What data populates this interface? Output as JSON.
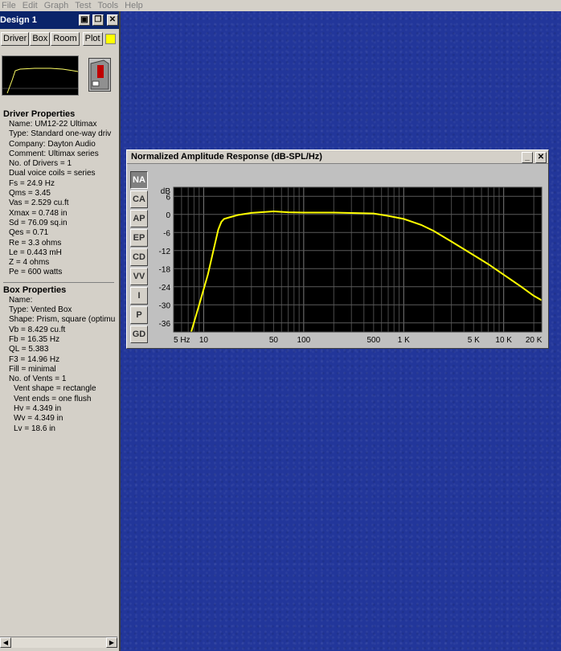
{
  "menu": [
    "File",
    "Edit",
    "Graph",
    "Test",
    "Tools",
    "Help"
  ],
  "design": {
    "title": "Design 1",
    "tabs": [
      "Driver",
      "Box",
      "Room",
      "Plot"
    ],
    "swatch_color": "#ffff00"
  },
  "driver": {
    "heading": "Driver Properties",
    "lines": [
      "Name: UM12-22  Ultimax",
      "Type: Standard one-way driv",
      "Company: Dayton Audio",
      "Comment: Ultimax series",
      "No. of Drivers = 1",
      "Dual voice coils = series",
      "Fs =  24.9 Hz",
      "Qms =  3.45",
      "Vas =  2.529 cu.ft",
      "Xmax =  0.748 in",
      "Sd =  76.09 sq.in",
      "Qes =  0.71",
      "Re =  3.3 ohms",
      "Le =  0.443 mH",
      "Z =  4 ohms",
      "Pe =  600 watts"
    ]
  },
  "box": {
    "heading": "Box Properties",
    "lines": [
      "Name:",
      "Type: Vented Box",
      "Shape: Prism, square (optimu",
      "Vb =  8.429 cu.ft",
      "Fb =  16.35 Hz",
      "QL =  5.383",
      "F3 =  14.96 Hz",
      "Fill = minimal",
      "No. of Vents = 1"
    ],
    "vent_lines": [
      "Vent shape = rectangle",
      "Vent ends = one flush",
      "Hv =  4.349 in",
      "Wv =  4.349 in",
      "Lv =  18.6 in"
    ]
  },
  "plot_window": {
    "title": "Normalized Amplitude Response (dB-SPL/Hz)",
    "side_tabs": [
      "NA",
      "CA",
      "AP",
      "EP",
      "CD",
      "VV",
      "I",
      "P",
      "GD"
    ],
    "active_tab": "NA"
  },
  "chart_data": {
    "type": "line",
    "xscale": "log",
    "xlim": [
      5,
      24000
    ],
    "ylim": [
      -39,
      9
    ],
    "yunit": "dB",
    "yticks": [
      6,
      0,
      -6,
      -12,
      -18,
      -24,
      -30,
      -36
    ],
    "xticks": [
      {
        "v": 5,
        "label": "5 Hz"
      },
      {
        "v": 10,
        "label": "10"
      },
      {
        "v": 50,
        "label": "50"
      },
      {
        "v": 100,
        "label": "100"
      },
      {
        "v": 500,
        "label": "500"
      },
      {
        "v": 1000,
        "label": "1 K"
      },
      {
        "v": 5000,
        "label": "5 K"
      },
      {
        "v": 10000,
        "label": "10 K"
      },
      {
        "v": 20000,
        "label": "20 K"
      }
    ],
    "line_color": "#ffff00",
    "grid": true,
    "series": [
      {
        "x": [
          7.5,
          9,
          11,
          12.5,
          14,
          15,
          16,
          18,
          22,
          30,
          50,
          70,
          100,
          200,
          500,
          700,
          1000,
          1500,
          2000,
          3000,
          5000,
          7000,
          10000,
          15000,
          20000,
          24000
        ],
        "y": [
          -39,
          -30,
          -20,
          -12,
          -5,
          -2.5,
          -1.5,
          -1,
          -0.2,
          0.5,
          1,
          0.7,
          0.6,
          0.6,
          0.3,
          -0.5,
          -1.5,
          -3.5,
          -5.5,
          -9,
          -13.5,
          -16.5,
          -20,
          -24,
          -27,
          -28.5
        ]
      }
    ]
  }
}
